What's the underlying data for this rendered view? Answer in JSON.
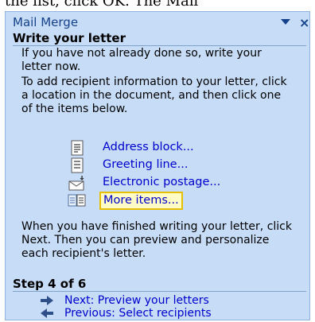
{
  "top_strip": {
    "text": "the list, click OK. The Mail"
  },
  "pane": {
    "title": "Mail Merge",
    "dropdown_icon": "chevron-down-icon",
    "close_label": "×"
  },
  "write_section": {
    "heading": "Write your letter",
    "para1": "If you have not already done so, write your letter now.",
    "para2": "To add recipient information to your letter, click a location in the document, and then click one of the items below.",
    "items": [
      {
        "label": "Address block...",
        "icon": "address-block-icon"
      },
      {
        "label": "Greeting line...",
        "icon": "greeting-line-icon"
      },
      {
        "label": "Electronic postage...",
        "icon": "electronic-postage-icon"
      },
      {
        "label": "More items...",
        "icon": "more-items-icon",
        "selected": true
      }
    ],
    "para3": "When you have finished writing your letter, click Next. Then you can preview and personalize each recipient's letter."
  },
  "step_section": {
    "heading": "Step 4 of 6",
    "next_label": "Next: Preview your letters",
    "previous_label": "Previous: Select recipients"
  },
  "colors": {
    "pane_bg": "#c6dcf7",
    "title_blue": "#15428b",
    "link_blue": "#0000cc",
    "highlight_bg": "#fffcc6",
    "highlight_border": "#e6c000"
  }
}
